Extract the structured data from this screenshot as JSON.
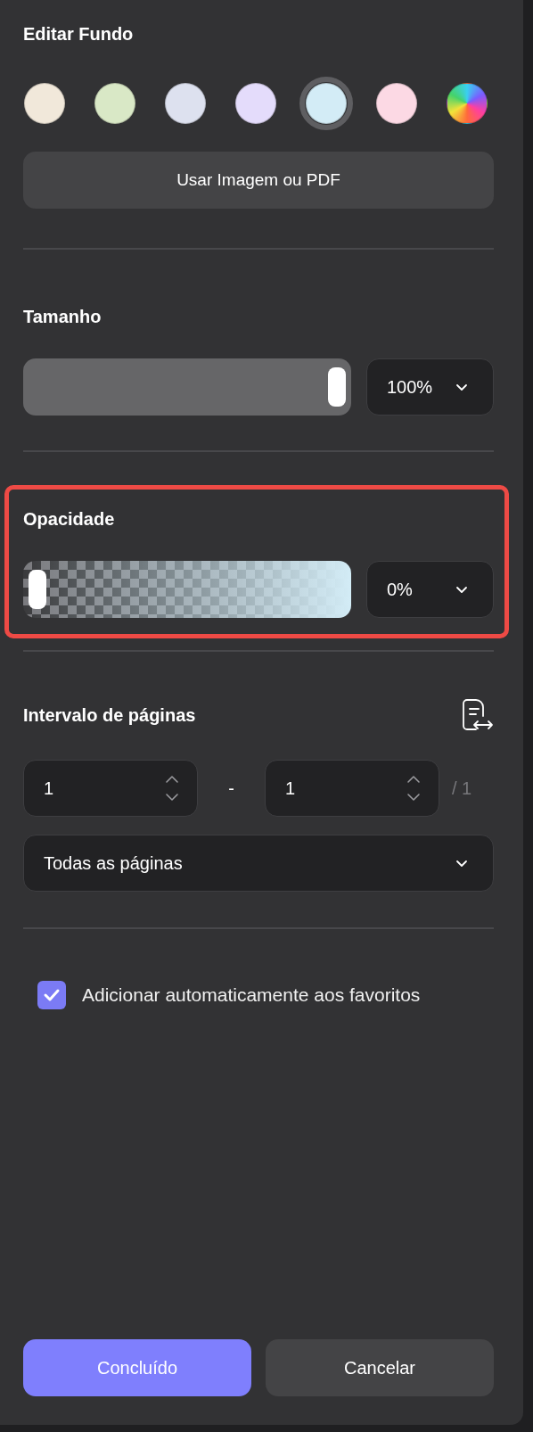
{
  "title": "Editar Fundo",
  "swatches": [
    {
      "kind": "color",
      "color": "#f1e8da",
      "selected": false
    },
    {
      "kind": "color",
      "color": "#d9e8c6",
      "selected": false
    },
    {
      "kind": "color",
      "color": "#dde1ef",
      "selected": false
    },
    {
      "kind": "color",
      "color": "#e4dcfb",
      "selected": false
    },
    {
      "kind": "color",
      "color": "#d3ecf6",
      "selected": true
    },
    {
      "kind": "color",
      "color": "#fcd9e4",
      "selected": false
    },
    {
      "kind": "picker",
      "selected": false
    }
  ],
  "image_button": "Usar Imagem ou PDF",
  "size": {
    "label": "Tamanho",
    "level": 1,
    "value": "100%"
  },
  "opacity": {
    "label": "Opacidade",
    "level": 0,
    "value": "0%",
    "highlighted": true
  },
  "page_range": {
    "label": "Intervalo de páginas",
    "from": "1",
    "separator": "-",
    "to": "1",
    "total": "/ 1",
    "scope": "Todas as páginas"
  },
  "auto_favorite": {
    "label": "Adicionar automaticamente aos favoritos",
    "checked": true
  },
  "buttons": [
    {
      "label": "Concluído",
      "kind": "primary"
    },
    {
      "label": "Cancelar",
      "kind": "secondary"
    }
  ]
}
